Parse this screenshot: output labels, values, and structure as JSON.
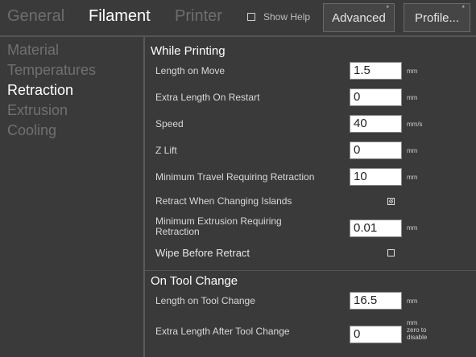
{
  "topbar": {
    "tabs": [
      "General",
      "Filament",
      "Printer"
    ],
    "show_help": "Show Help",
    "advanced": "Advanced",
    "profile": "Profile...",
    "corner_mark": "*"
  },
  "sidebar": {
    "items": [
      "Material",
      "Temperatures",
      "Retraction",
      "Extrusion",
      "Cooling"
    ]
  },
  "while_printing": {
    "title": "While Printing",
    "length_on_move": {
      "label": "Length on Move",
      "value": "1.5",
      "unit": "mm"
    },
    "extra_length_on_restart": {
      "label": "Extra Length On Restart",
      "value": "0",
      "unit": "mm"
    },
    "speed": {
      "label": "Speed",
      "value": "40",
      "unit": "mm/s"
    },
    "z_lift": {
      "label": "Z Lift",
      "value": "0",
      "unit": "mm"
    },
    "min_travel": {
      "label": "Minimum Travel Requiring Retraction",
      "value": "10",
      "unit": "mm"
    },
    "retract_islands": {
      "label": "Retract When Changing Islands",
      "checked": true
    },
    "min_extrusion": {
      "label_line1": "Minimum Extrusion Requiring",
      "label_line2": "Retraction",
      "value": "0.01",
      "unit": "mm"
    },
    "wipe": {
      "label": "Wipe Before Retract",
      "checked": false
    }
  },
  "tool_change": {
    "title": "On Tool Change",
    "length": {
      "label": "Length on Tool Change",
      "value": "16.5",
      "unit": "mm"
    },
    "extra_length": {
      "label": "Extra Length After Tool Change",
      "value": "0",
      "unit_line1": "mm",
      "unit_line2": "zero to",
      "unit_line3": "disable"
    }
  }
}
